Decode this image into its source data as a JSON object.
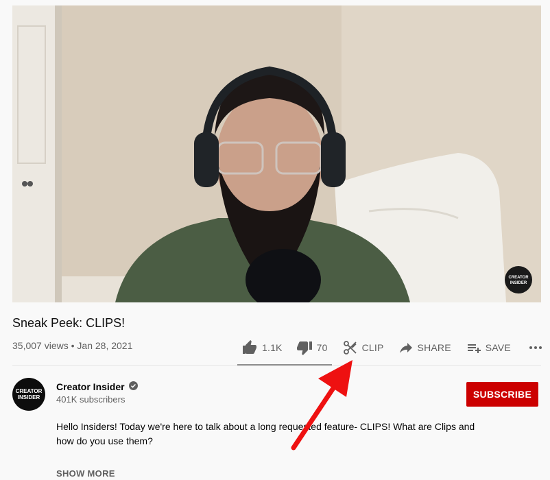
{
  "video": {
    "watermark_line1": "CREATOR",
    "watermark_line2": "INSIDER"
  },
  "title": "Sneak Peek: CLIPS!",
  "meta": {
    "views": "35,007 views",
    "separator": "•",
    "date": "Jan 28, 2021"
  },
  "actions": {
    "like_count": "1.1K",
    "dislike_count": "70",
    "clip_label": "CLIP",
    "share_label": "SHARE",
    "save_label": "SAVE"
  },
  "channel": {
    "name": "Creator Insider",
    "subscribers": "401K subscribers",
    "avatar_line1": "CREATOR",
    "avatar_line2": "INSIDER"
  },
  "subscribe_label": "SUBSCRIBE",
  "description": {
    "text": "Hello Insiders! Today we're here to talk about a long requested feature- CLIPS! What are Clips and how do you use them?",
    "show_more_label": "SHOW MORE"
  },
  "colors": {
    "subscribe_bg": "#cc0000",
    "annotation_arrow": "#ee1111",
    "secondary_text": "#606060"
  }
}
